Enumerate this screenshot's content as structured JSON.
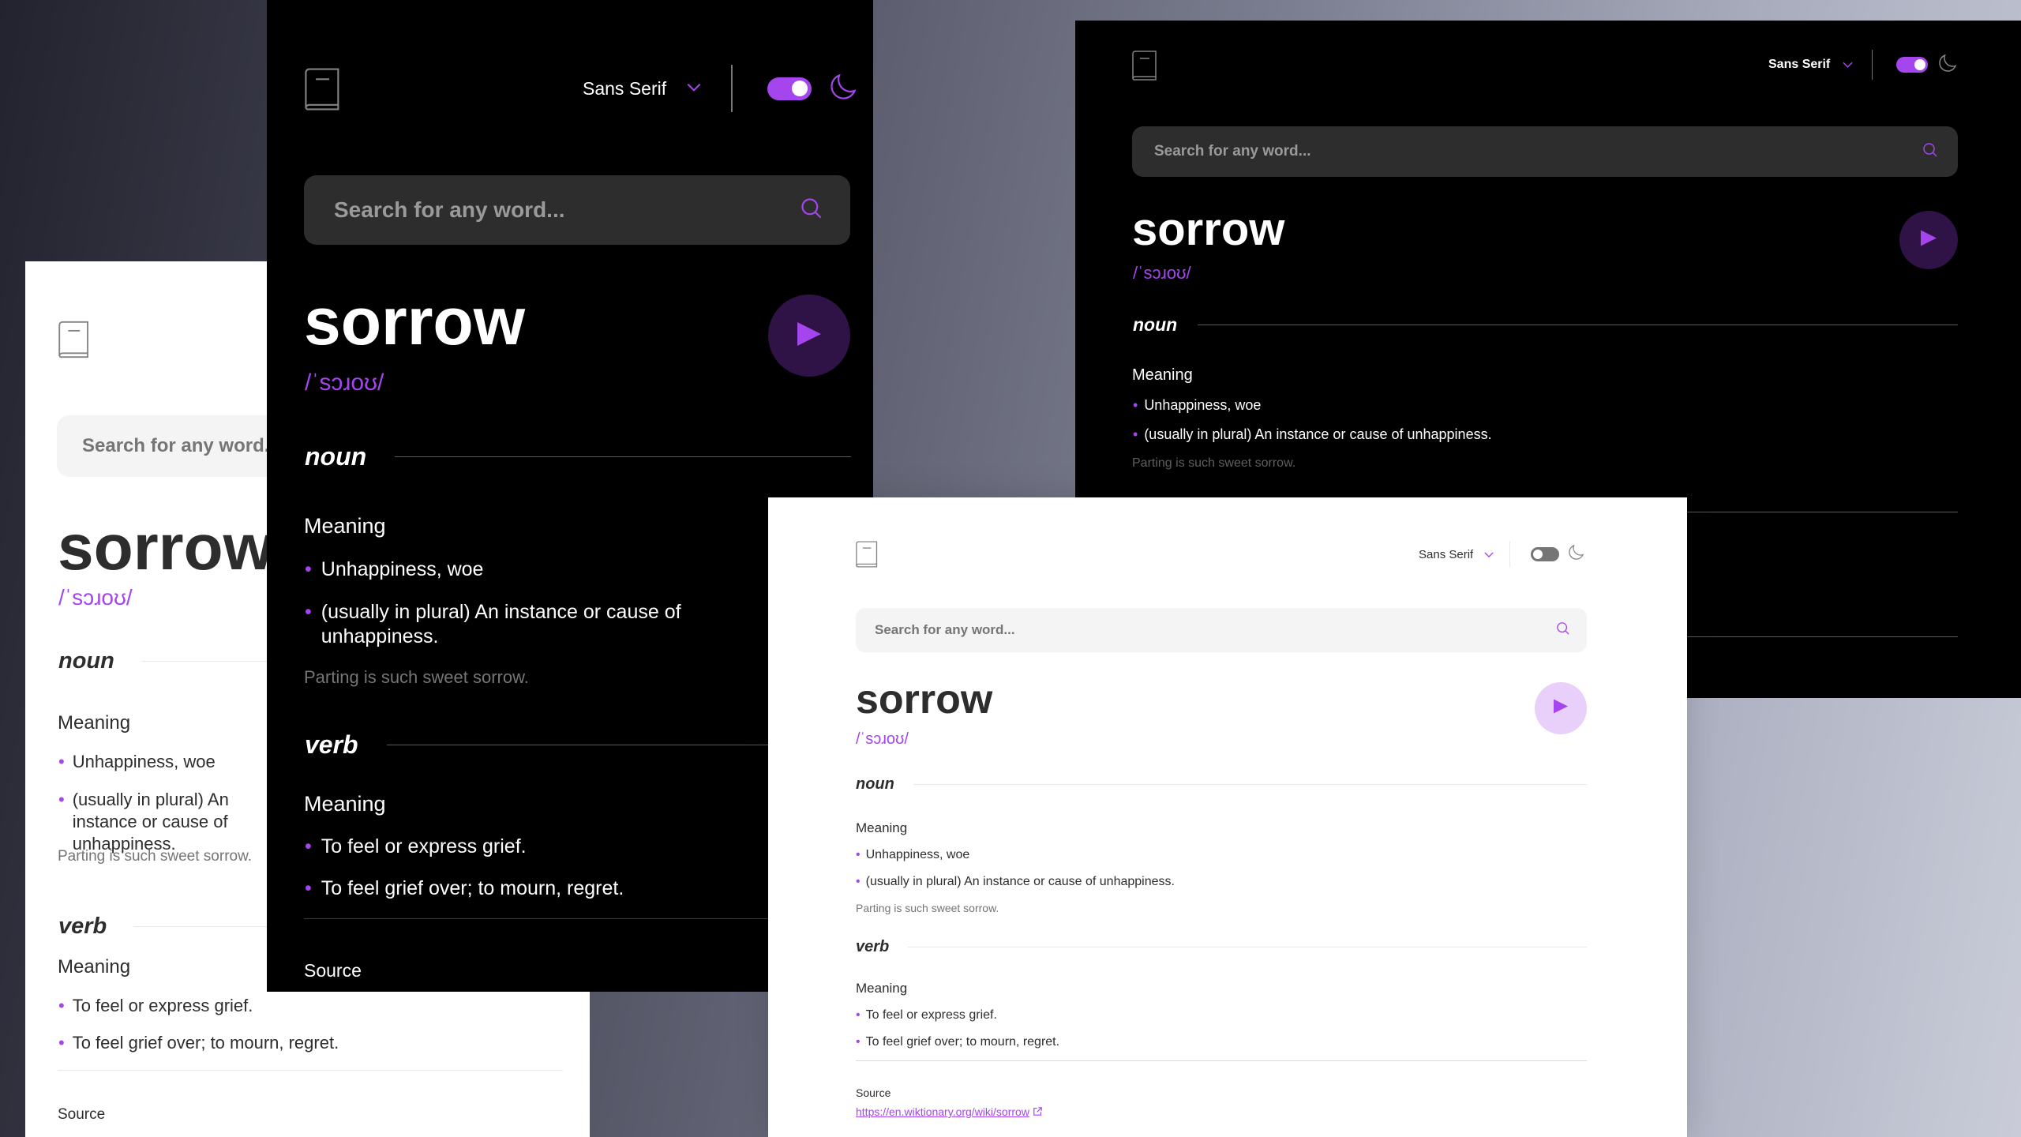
{
  "app": {
    "font_label": "Sans Serif",
    "search_placeholder": "Search for any word...",
    "accent_color": "#a445ed"
  },
  "entry": {
    "word": "sorrow",
    "phonetic": "/ˈsɔɹoʊ/",
    "noun_label": "noun",
    "verb_label": "verb",
    "meaning_label": "Meaning",
    "noun_defs": [
      "Unhappiness, woe",
      "(usually in plural) An instance or cause of unhappiness."
    ],
    "noun_defs_mobile": [
      "Unhappiness, woe",
      "(usually in plural) An instance or cause of unhappiness."
    ],
    "noun_example": "Parting is such sweet sorrow.",
    "verb_defs": [
      "To feel or express grief.",
      "To feel grief over; to mourn, regret."
    ],
    "source_label": "Source",
    "source_url": "https://en.wiktionary.org/wiki/sorrow"
  },
  "icons": {
    "logo": "book-icon",
    "chevron": "chevron-down-icon",
    "theme": "moon-icon",
    "search": "search-icon",
    "play": "play-icon",
    "external": "external-link-icon"
  },
  "theme_state": {
    "light_left": "light",
    "dark_mobile": "dark",
    "dark_desktop": "dark",
    "light_front": "light"
  }
}
